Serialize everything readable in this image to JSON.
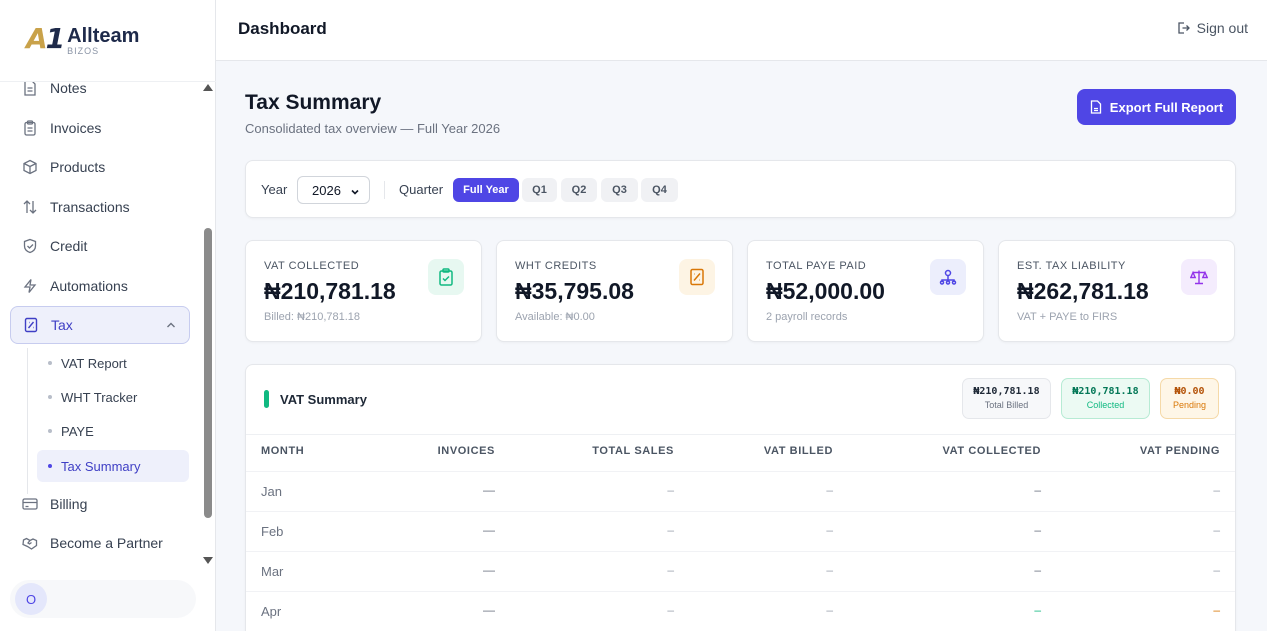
{
  "brand": {
    "name": "Allteam",
    "sub": "BIZOS",
    "mark": "A1"
  },
  "sidebar": {
    "items": [
      {
        "label": "Notes",
        "icon": "file-icon"
      },
      {
        "label": "Invoices",
        "icon": "clipboard-icon"
      },
      {
        "label": "Products",
        "icon": "box-icon"
      },
      {
        "label": "Transactions",
        "icon": "arrows-updown-icon"
      },
      {
        "label": "Credit",
        "icon": "shield-check-icon"
      },
      {
        "label": "Automations",
        "icon": "bolt-icon"
      },
      {
        "label": "Tax",
        "icon": "receipt-icon"
      },
      {
        "label": "Billing",
        "icon": "credit-card-icon"
      },
      {
        "label": "Become a Partner",
        "icon": "handshake-icon"
      }
    ],
    "tax_sub": [
      "VAT Report",
      "WHT Tracker",
      "PAYE",
      "Tax Summary"
    ],
    "user_initial": "O"
  },
  "header": {
    "title": "Dashboard",
    "signout": "Sign out"
  },
  "summary": {
    "title": "Tax Summary",
    "subtitle": "Consolidated tax overview — Full Year 2026",
    "export_label": "Export Full Report"
  },
  "filters": {
    "year_label": "Year",
    "year_value": "2026",
    "quarter_label": "Quarter",
    "quarters": [
      "Full Year",
      "Q1",
      "Q2",
      "Q3",
      "Q4"
    ],
    "active_quarter": "Full Year"
  },
  "stats": [
    {
      "label": "VAT COLLECTED",
      "value": "₦210,781.18",
      "note": "Billed: ₦210,781.18",
      "icon": "clipboard-check-icon",
      "color": "#10b981",
      "bg": "#e7f8f1"
    },
    {
      "label": "WHT CREDITS",
      "value": "₦35,795.08",
      "note": "Available: ₦0.00",
      "icon": "receipt-icon",
      "color": "#d97706",
      "bg": "#fdf4e4"
    },
    {
      "label": "TOTAL PAYE PAID",
      "value": "₦52,000.00",
      "note": "2 payroll records",
      "icon": "users-icon",
      "color": "#4f46e5",
      "bg": "#eceefc"
    },
    {
      "label": "EST. TAX LIABILITY",
      "value": "₦262,781.18",
      "note": "VAT + PAYE to FIRS",
      "icon": "scale-icon",
      "color": "#9333ea",
      "bg": "#f4ecfd"
    }
  ],
  "vat": {
    "title": "VAT Summary",
    "pills": [
      {
        "value": "₦210,781.18",
        "label": "Total Billed",
        "fg": "#1f2937",
        "lc": "#6b7280",
        "bg": "#f7f8fa",
        "border": "#e5e7eb"
      },
      {
        "value": "₦210,781.18",
        "label": "Collected",
        "fg": "#047857",
        "lc": "#10b981",
        "bg": "#ecfaf3",
        "border": "#b7ebd4"
      },
      {
        "value": "₦0.00",
        "label": "Pending",
        "fg": "#b45309",
        "lc": "#d97706",
        "bg": "#fef6e7",
        "border": "#f5d9a8"
      }
    ],
    "columns": [
      "MONTH",
      "INVOICES",
      "TOTAL SALES",
      "VAT BILLED",
      "VAT COLLECTED",
      "VAT PENDING"
    ],
    "rows": [
      {
        "month": "Jan",
        "invoices": "—",
        "sales": "–",
        "billed": "–",
        "collected": "–",
        "pending": "–"
      },
      {
        "month": "Feb",
        "invoices": "—",
        "sales": "–",
        "billed": "–",
        "collected": "–",
        "pending": "–"
      },
      {
        "month": "Mar",
        "invoices": "—",
        "sales": "–",
        "billed": "–",
        "collected": "–",
        "pending": "–"
      },
      {
        "month": "Apr",
        "invoices": "—",
        "sales": "–",
        "billed": "–",
        "collected": "–",
        "pending": "–"
      }
    ]
  }
}
